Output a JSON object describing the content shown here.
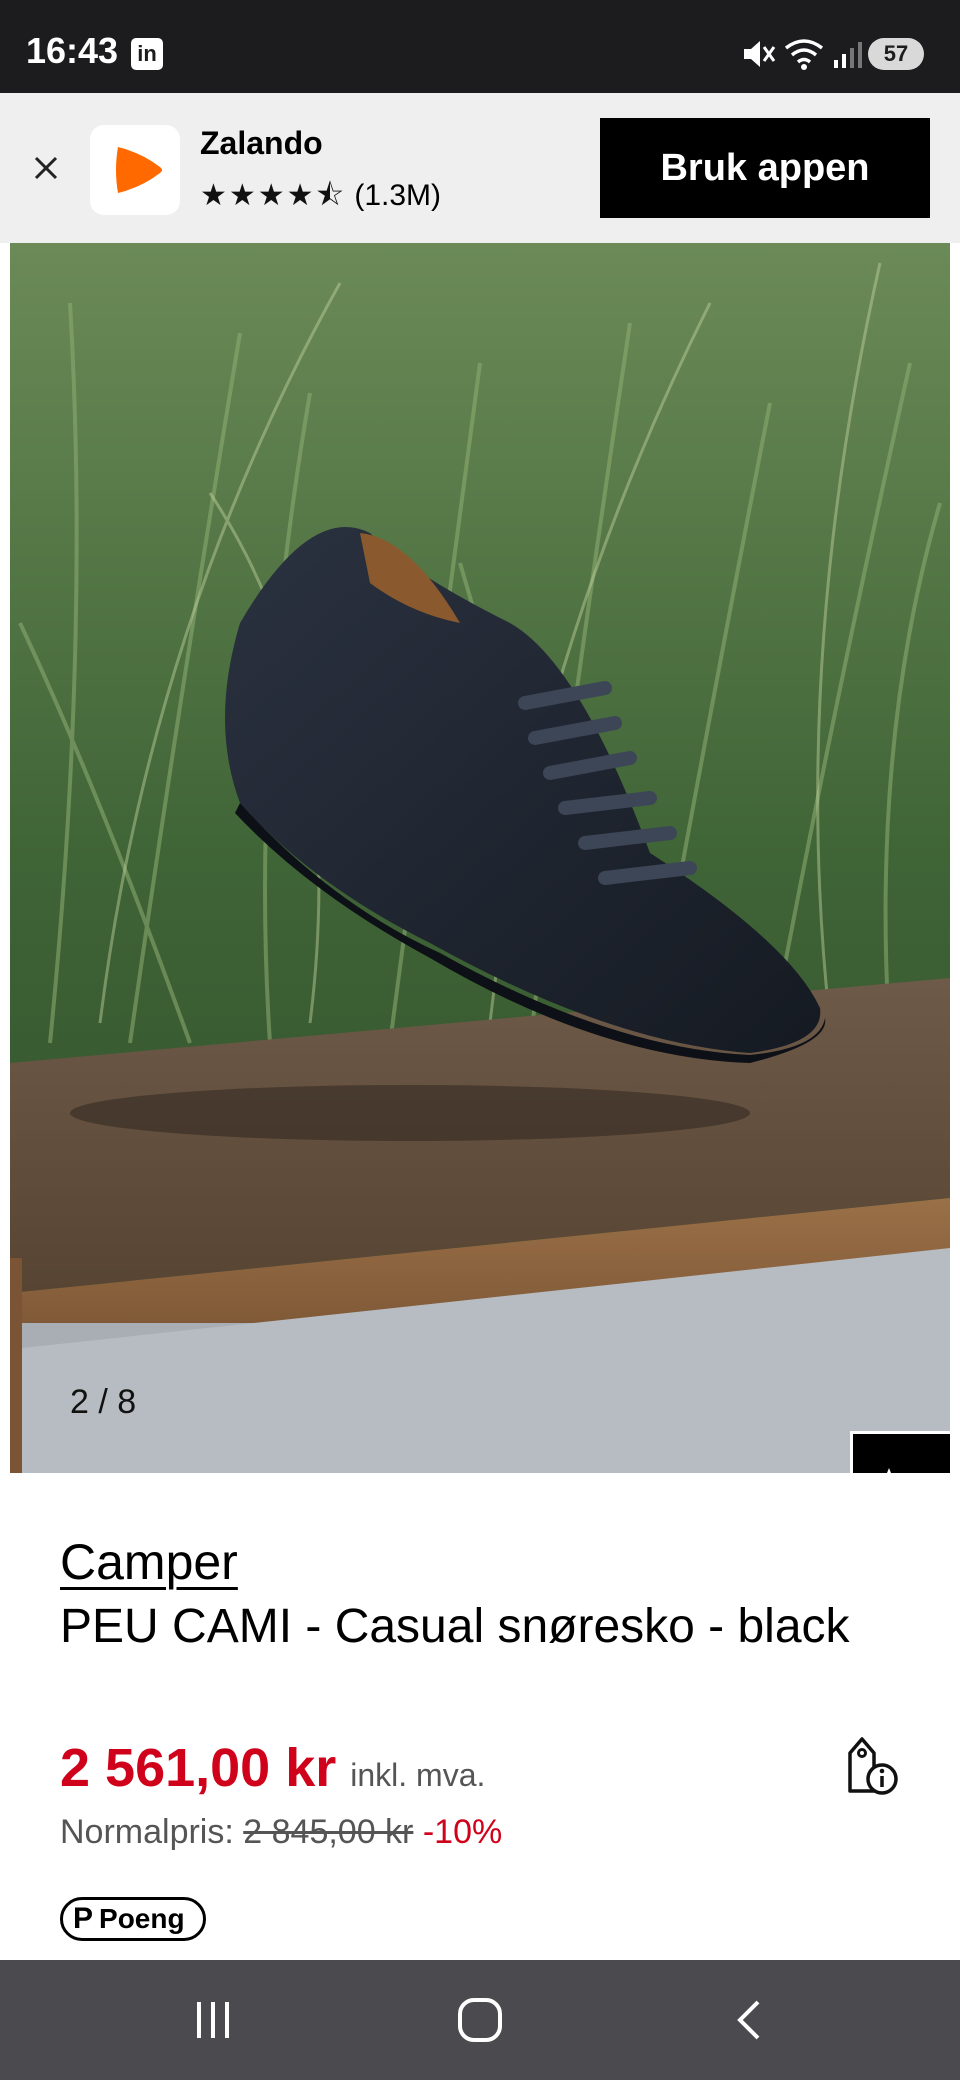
{
  "status_bar": {
    "time": "16:43",
    "linkedin_glyph": "in",
    "battery": "57",
    "icons": [
      "linkedin-icon",
      "mute-icon",
      "wifi-icon",
      "signal-icon",
      "battery-icon"
    ]
  },
  "app_banner": {
    "app_name": "Zalando",
    "stars": "★★★★⯪",
    "rating_count": "(1.3M)",
    "cta_label": "Bruk appen",
    "brand_color": "#ff6900"
  },
  "product_image": {
    "counter": "2 / 8"
  },
  "product": {
    "brand": "Camper",
    "title": "PEU CAMI - Casual snøresko - black",
    "price": "2 561,00 kr",
    "price_note": "inkl. mva.",
    "normal_price_label": "Normalpris:",
    "old_price": "2 845,00 kr",
    "discount": "-10%",
    "points_label": "Poeng",
    "points_mark": "P",
    "price_color": "#d0021b"
  },
  "nav_bar": {
    "buttons": [
      "recent-apps",
      "home",
      "back"
    ]
  }
}
